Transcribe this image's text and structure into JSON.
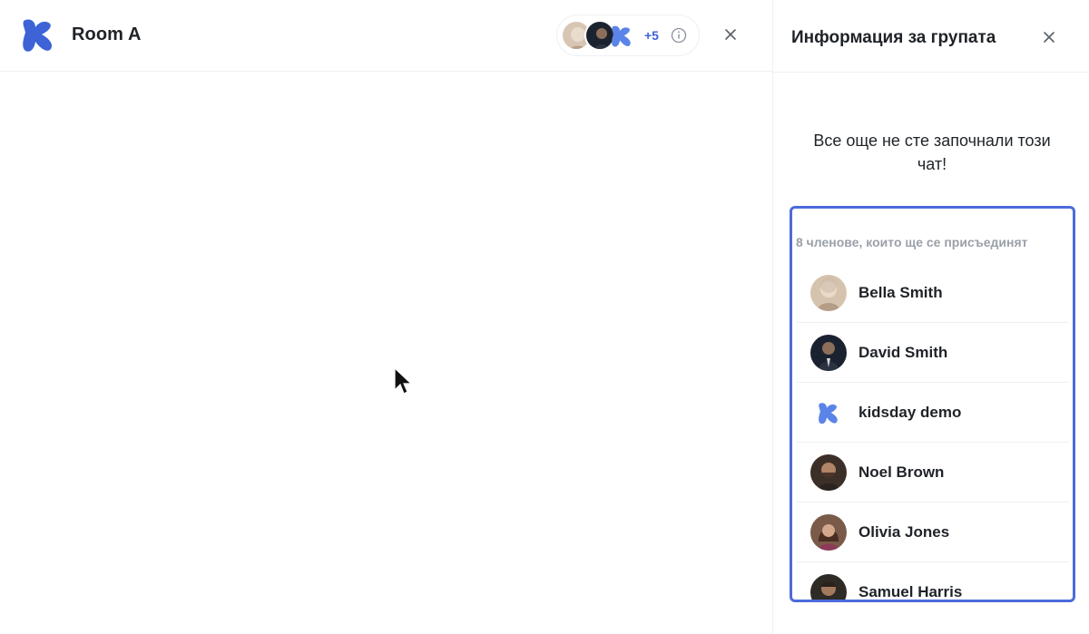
{
  "chat": {
    "title": "Room A",
    "members_extra": "+5"
  },
  "panel": {
    "title": "Информация за групата",
    "empty_message": "Все още не сте започнали този чат!",
    "members_heading": "8 членове, които ще се присъединят",
    "members": [
      {
        "name": "Bella Smith",
        "avatar": "photo-elderly"
      },
      {
        "name": "David Smith",
        "avatar": "photo-dark-suit"
      },
      {
        "name": "kidsday demo",
        "avatar": "brand-logo"
      },
      {
        "name": "Noel Brown",
        "avatar": "photo-bearded"
      },
      {
        "name": "Olivia Jones",
        "avatar": "photo-woman"
      },
      {
        "name": "Samuel Harris",
        "avatar": "photo-man"
      }
    ]
  },
  "colors": {
    "brand_blue": "#3d63d6",
    "highlight_border": "#4d6bdc",
    "muted_text": "#9aa0a8"
  }
}
